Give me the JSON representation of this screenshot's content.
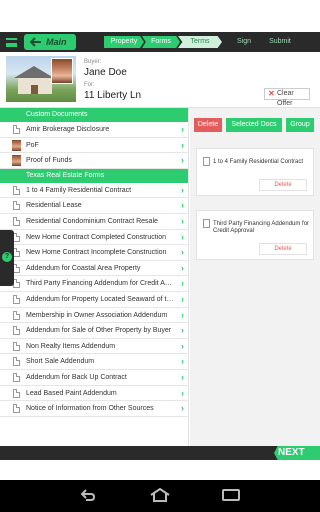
{
  "topbar": {
    "main_label": "Main",
    "steps": [
      "Property",
      "Forms",
      "Terms",
      "Sign",
      "Submit"
    ]
  },
  "header": {
    "buyer_label": "Buyer:",
    "buyer_name": "Jane Doe",
    "for_label": "For:",
    "address": "11 Liberty Ln",
    "clear_label": "Clear Offer"
  },
  "custom_documents": {
    "heading": "Custom Documents",
    "items": [
      {
        "label": "Amir Brokerage Disclosure",
        "icon": "document-icon"
      },
      {
        "label": "PoF",
        "icon": "photo-icon"
      },
      {
        "label": "Proof of Funds",
        "icon": "photo-icon"
      }
    ]
  },
  "texas_forms": {
    "heading": "Texas Real Estate Forms",
    "items": [
      "1 to 4 Family Residential Contract",
      "Residential Lease",
      "Residential Condominium Contract Resale",
      "New Home Contract Completed Construction",
      "New Home Contract Incomplete Construction",
      "Addendum for Coastal Area Property",
      "Third Party Financing Addendum for Credit Approval",
      "Addendum for Property Located Seaward of the Gulf Intracoastal Waterway",
      "Membership in Owner Association Addendum",
      "Addendum for Sale of Other Property by Buyer",
      "Non Realty Items Addendum",
      "Short Sale Addendum",
      "Addendum for Back Up Contract",
      "Lead Based Paint Addendum",
      "Notice of Information from Other Sources"
    ]
  },
  "right_panel": {
    "tabs": {
      "delete": "Delete",
      "selected_docs": "Selected Docs",
      "group": "Group"
    },
    "cards": [
      {
        "title": "1 to 4 Family Residential Contract",
        "delete": "Delete"
      },
      {
        "title": "Third Party Financing Addendum for Credit Approval",
        "delete": "Delete"
      }
    ]
  },
  "footer": {
    "next_label": "NEXT"
  },
  "colors": {
    "accent": "#2ecc71",
    "danger": "#e35d5d",
    "dark": "#2a2a2a"
  }
}
